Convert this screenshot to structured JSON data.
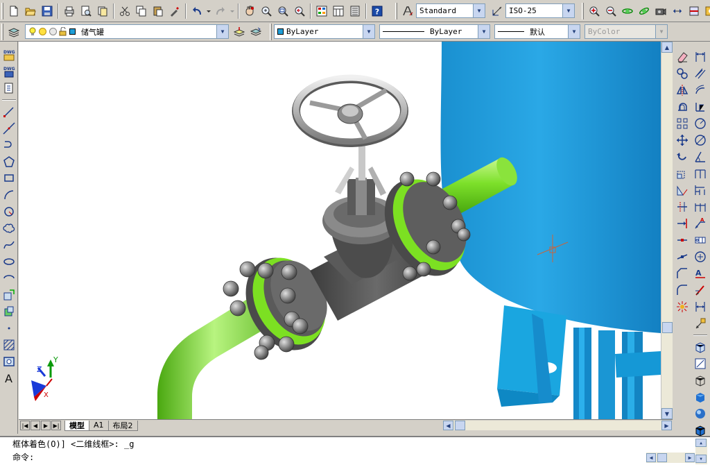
{
  "toolbar1": {
    "icons": [
      "new-icon",
      "open-icon",
      "save-icon",
      "plot-icon",
      "plot-preview-icon",
      "publish-icon",
      "cut-icon",
      "copy-icon",
      "paste-icon",
      "match-properties-icon",
      "undo-icon",
      "undo-dropdown-icon",
      "redo-icon",
      "redo-dropdown-icon",
      "pan-icon",
      "zoom-realtime-icon",
      "zoom-window-icon",
      "zoom-previous-icon",
      "properties-icon",
      "design-center-icon",
      "tool-palettes-icon",
      "help-icon"
    ],
    "text_style": "Standard",
    "dim_style": "ISO-25"
  },
  "toolbar2": {
    "layer_name": "储气罐",
    "color_control": "ByLayer",
    "linetype_control": "ByLayer",
    "lineweight_control": "默认",
    "plotstyle_control": "ByColor"
  },
  "layout_tabs": [
    "模型",
    "A1",
    "布局2"
  ],
  "command": {
    "history": "框体着色(O)] <二维线框>: _g",
    "prompt": "命令:"
  },
  "ucs": {
    "x": "X",
    "y": "Y",
    "z": "Z"
  },
  "colors": {
    "pipe": "#6fd319",
    "tank": "#1e9ed8",
    "valve": "#5a5a5a",
    "crosshair": "#c8643c"
  }
}
